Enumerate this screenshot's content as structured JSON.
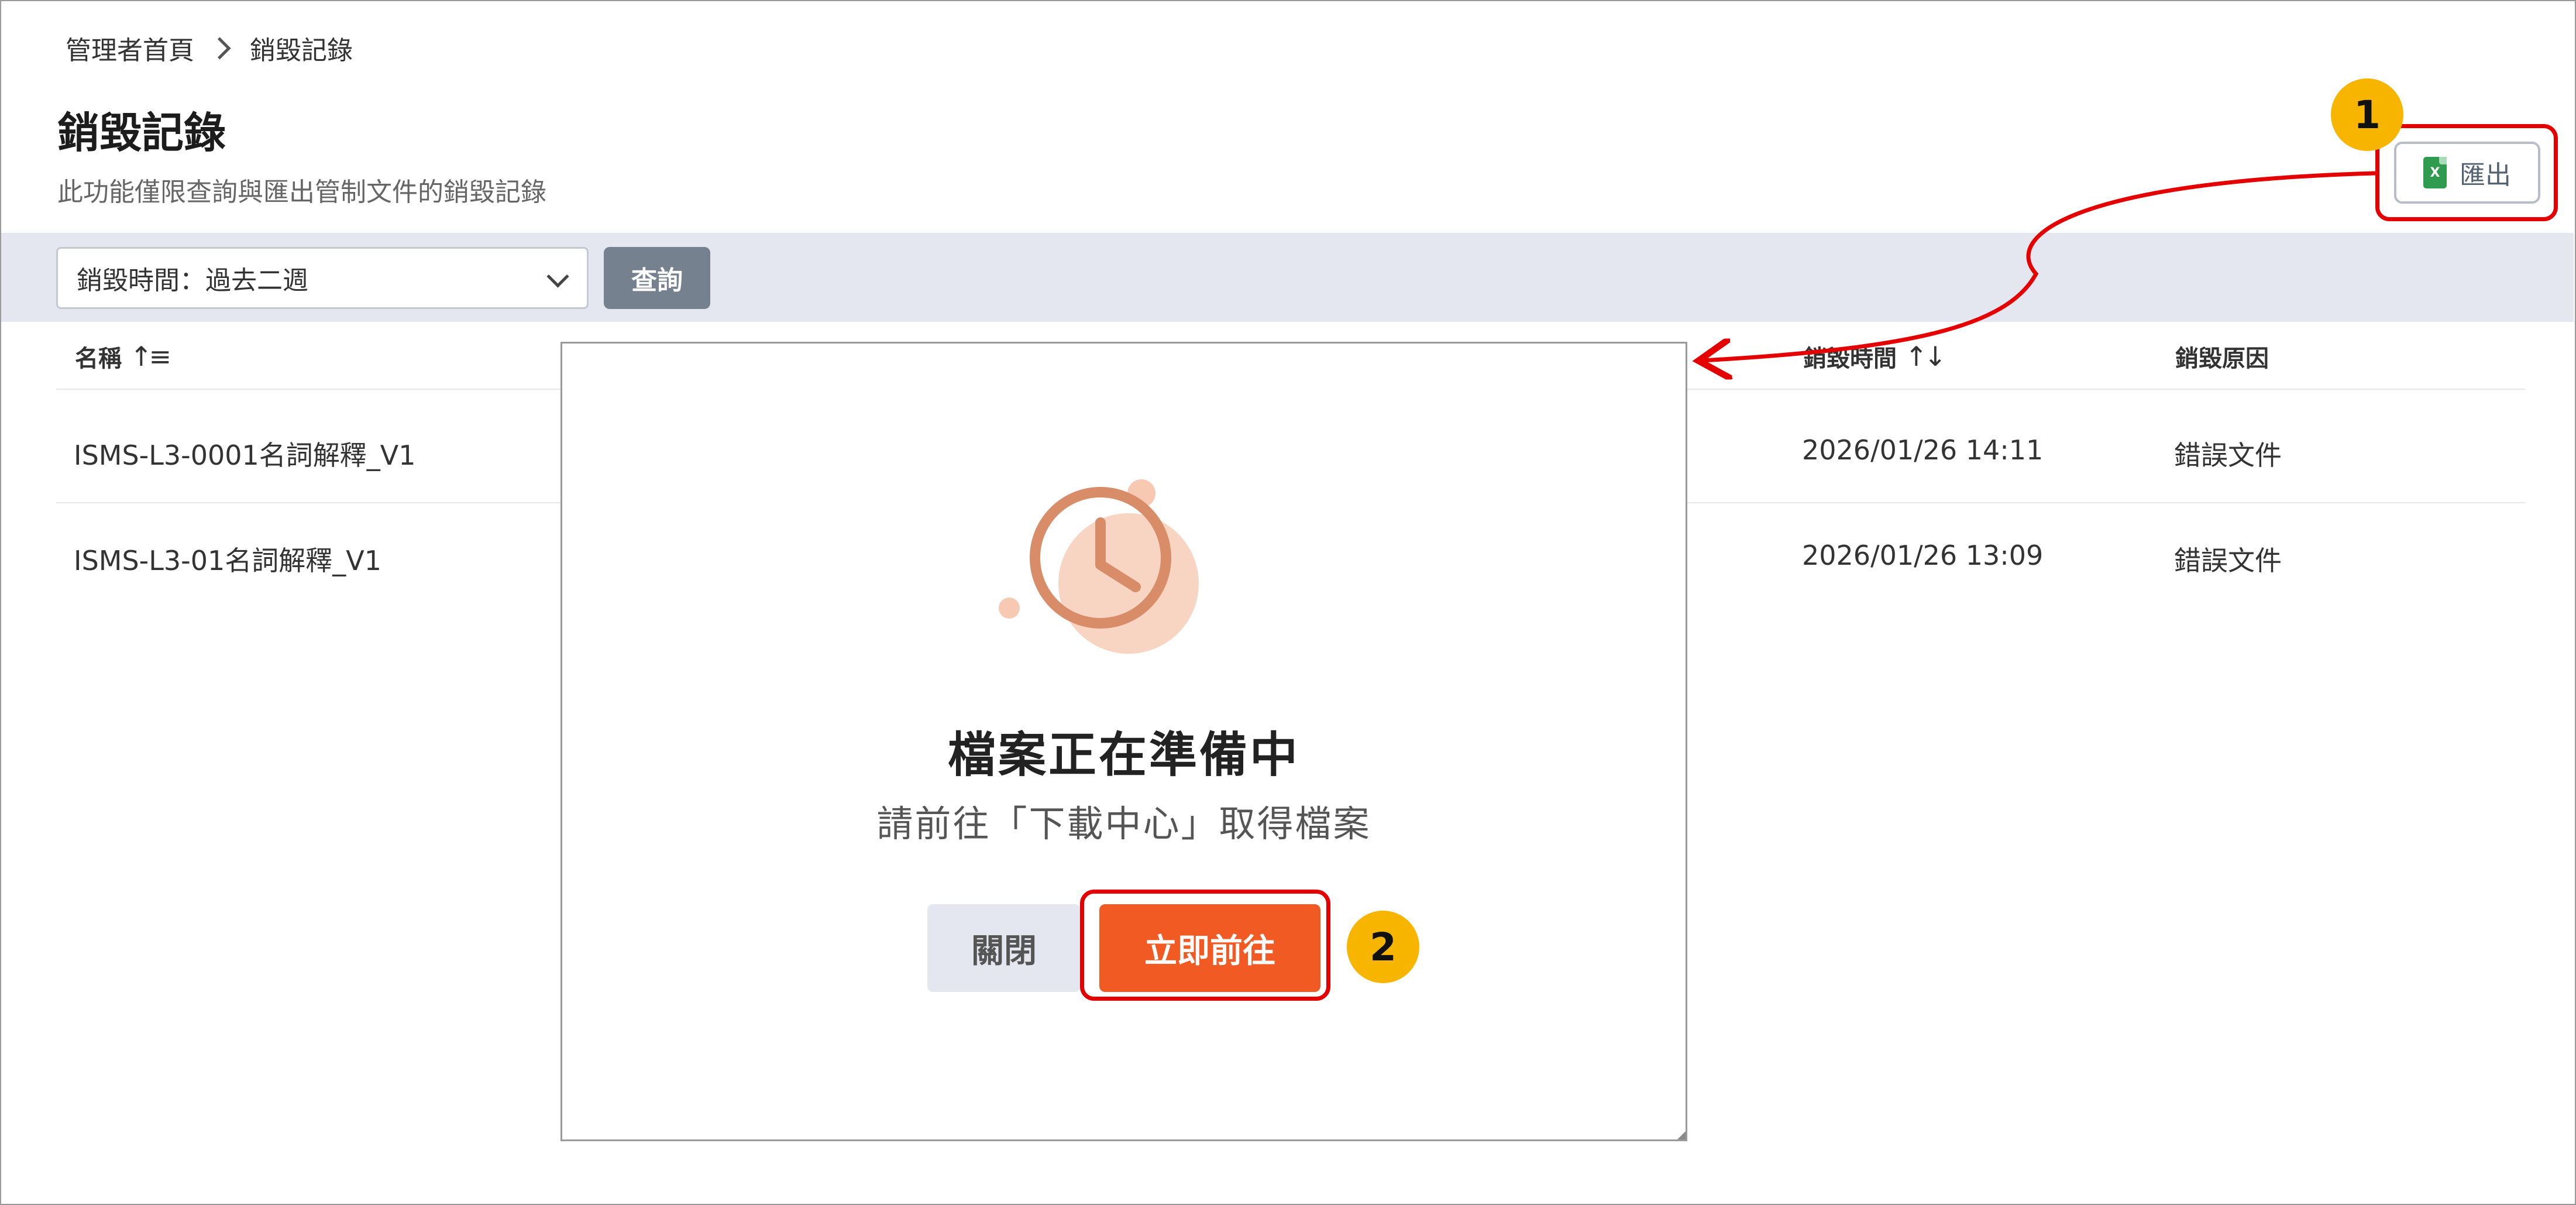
{
  "breadcrumb": {
    "home": "管理者首頁",
    "current": "銷毀記錄"
  },
  "page": {
    "title": "銷毀記錄",
    "description": "此功能僅限查詢與匯出管制文件的銷毀記錄"
  },
  "toolbar": {
    "export_label": "匯出",
    "export_icon": "excel-file-icon",
    "export_icon_letter": "X"
  },
  "filter": {
    "selected": "銷毀時間：過去二週",
    "query_label": "查詢"
  },
  "table": {
    "headers": {
      "name": "名稱",
      "time": "銷毀時間",
      "reason": "銷毀原因"
    },
    "rows": [
      {
        "name": "ISMS-L3-0001名詞解釋_V1",
        "time": "2026/01/26 14:11",
        "reason": "錯誤文件"
      },
      {
        "name": "ISMS-L3-01名詞解釋_V1",
        "time": "2026/01/26 13:09",
        "reason": "錯誤文件"
      }
    ]
  },
  "modal": {
    "icon": "clock-icon",
    "title": "檔案正在準備中",
    "subtitle": "請前往「下載中心」取得檔案",
    "close_label": "關閉",
    "go_label": "立即前往"
  },
  "annotations": {
    "step1": "1",
    "step2": "2"
  },
  "colors": {
    "accent": "#f25a24",
    "highlight": "#e50000",
    "badge": "#f7b500",
    "filter_bar": "#e4e7ef"
  }
}
